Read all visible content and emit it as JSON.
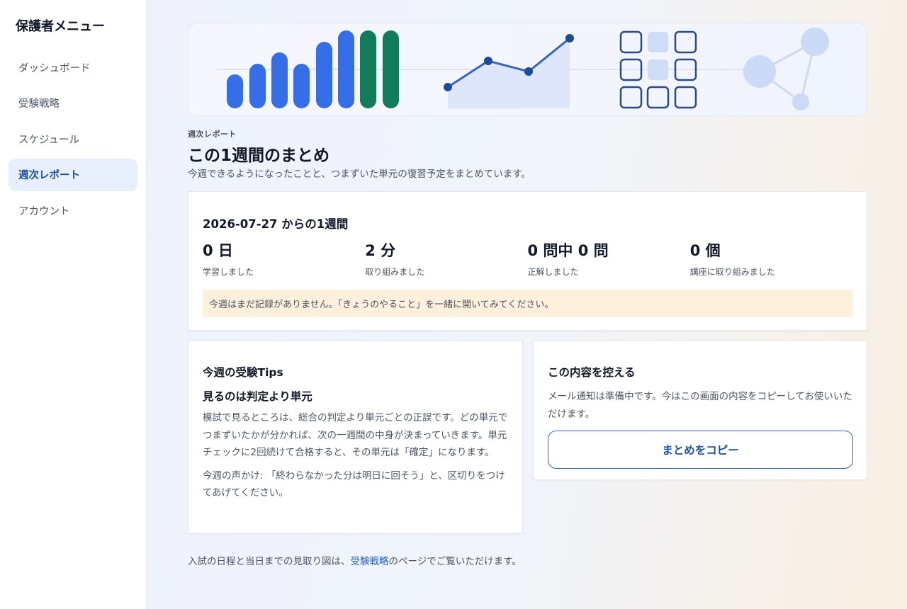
{
  "sidebar": {
    "title": "保護者メニュー",
    "items": [
      {
        "label": "ダッシュボード"
      },
      {
        "label": "受験戦略"
      },
      {
        "label": "スケジュール"
      },
      {
        "label": "週次レポート"
      },
      {
        "label": "アカウント"
      }
    ]
  },
  "header": {
    "eyebrow": "週次レポート",
    "title": "この1週間のまとめ",
    "subtitle": "今週できるようになったことと、つまずいた単元の復習予定をまとめています。"
  },
  "summary": {
    "heading": "2026-07-27 からの1週間",
    "stats": [
      {
        "value": "0 日",
        "label": "学習しました"
      },
      {
        "value": "2 分",
        "label": "取り組みました"
      },
      {
        "value": "0 問中 0 問",
        "label": "正解しました"
      },
      {
        "value": "0 個",
        "label": "講座に取り組みました"
      }
    ],
    "notice": "今週はまだ記録がありません。「きょうのやること」を一緒に開いてみてください。"
  },
  "tips": {
    "title": "今週の受験Tips",
    "heading": "見るのは判定より単元",
    "body": "模試で見るところは、総合の判定より単元ごとの正誤です。どの単元でつまずいたかが分かれば、次の一週間の中身が決まっていきます。単元チェックに2回続けて合格すると、その単元は「確定」になります。",
    "voice": "今週の声かけ: 「終わらなかった分は明日に回そう」と、区切りをつけてあげてください。"
  },
  "copy": {
    "title": "この内容を控える",
    "description": "メール通知は準備中です。今はこの画面の内容をコピーしてお使いいただけます。",
    "button_label": "まとめをコピー"
  },
  "footer": {
    "prefix": "入試の日程と当日までの見取り図は、",
    "link": "受験戦略",
    "suffix": "のページでご覧いただけます。"
  },
  "colors": {
    "accent": "#2f62c4",
    "bar_blue": "#356ee6",
    "bar_green": "#137a5a",
    "notice_bg": "#fdf0dc"
  }
}
